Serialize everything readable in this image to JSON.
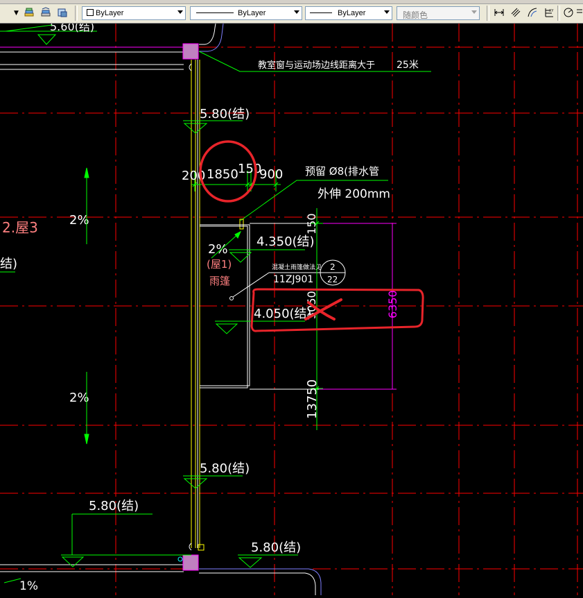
{
  "toolbar": {
    "color_control": "ByLayer",
    "linetype_control": "ByLayer",
    "lineweight_control": "ByLayer",
    "plotstyle_control": "随颜色",
    "icons": [
      "layer-states-icon",
      "layer-previous-icon",
      "layer-isolate-icon",
      "linear-dimension-icon",
      "aligned-dimension-icon",
      "arc-length-icon",
      "ordinate-dimension-icon",
      "radius-dimension-icon"
    ]
  },
  "drawing": {
    "colors": {
      "background": "#000000",
      "axis_red": "#ff0000",
      "wall_yellow": "#ffff00",
      "dim_green": "#00ff00",
      "text_white": "#ffffff",
      "magenta": "#ff00ff",
      "markup_red": "#e8242a",
      "ramp_pink": "#ff8080"
    },
    "top_elev_partial": "5.60(结)",
    "note_distance": "教室窗与运动场边线距离大于",
    "note_distance_value": "25米",
    "elev_580_upper": "5.80(结)",
    "dim_200": "200",
    "dim_1850": "1850",
    "dim_150": "150",
    "dim_900": "900",
    "drain_note_line1": "预留 Ø8(排水管",
    "drain_note_line2": "外伸 200mm",
    "left_label": "2.屋3",
    "left_elev_partial": "结)",
    "slope_left_upper": "2%",
    "slope_canopy": "2%",
    "canopy_label": "(屋1)",
    "canopy_name": "雨篷",
    "elev_4350": "4.350(结)",
    "detail_note": "混凝土雨篷做法见",
    "detail_ref": "11ZJ901",
    "detail_circle_top": "2",
    "detail_circle_bottom": "22",
    "dim_150_vertical": "150",
    "elev_4050": "4.050(结)",
    "dim_3050_vertical": "3050",
    "dim_6350_vertical": "6350",
    "dim_13750_vertical": "13750",
    "slope_left_lower": "2%",
    "elev_580_mid": "5.80(结)",
    "elev_580_left": "5.80(结)",
    "elev_580_bottom": "5.80(结)",
    "slope_bottom": "1%"
  }
}
